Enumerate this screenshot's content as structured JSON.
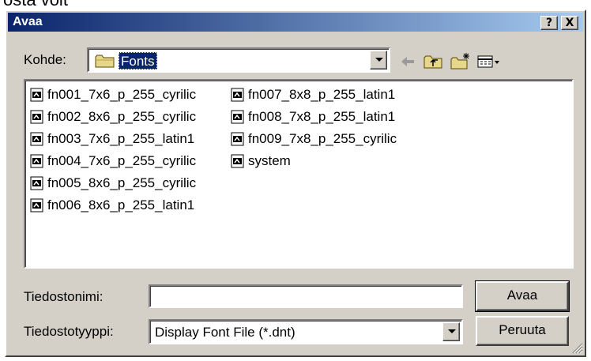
{
  "background": {
    "text": "osta voit"
  },
  "titlebar": {
    "title": "Avaa",
    "help_label": "?",
    "close_label": "X"
  },
  "lookin": {
    "label": "Kohde:",
    "value": "Fonts"
  },
  "toolbar": {
    "icons": [
      "back-arrow-icon",
      "up-folder-icon",
      "new-folder-icon",
      "view-menu-icon"
    ]
  },
  "files": [
    {
      "name": "fn001_7x6_p_255_cyrilic"
    },
    {
      "name": "fn002_8x6_p_255_cyrilic"
    },
    {
      "name": "fn003_7x6_p_255_latin1"
    },
    {
      "name": "fn004_7x6_p_255_cyrilic"
    },
    {
      "name": "fn005_8x6_p_255_cyrilic"
    },
    {
      "name": "fn006_8x6_p_255_latin1"
    },
    {
      "name": "fn007_8x8_p_255_latin1"
    },
    {
      "name": "fn008_7x8_p_255_latin1"
    },
    {
      "name": "fn009_7x8_p_255_cyrilic"
    },
    {
      "name": "system"
    }
  ],
  "filename": {
    "label": "Tiedostonimi:",
    "value": ""
  },
  "filetype": {
    "label": "Tiedostotyyppi:",
    "value": "Display Font File (*.dnt)"
  },
  "buttons": {
    "open": "Avaa",
    "cancel": "Peruuta"
  },
  "colors": {
    "titlebar_start": "#0a246a",
    "titlebar_end": "#a6caf0",
    "face": "#d4d0c8",
    "selection": "#0a246a"
  }
}
